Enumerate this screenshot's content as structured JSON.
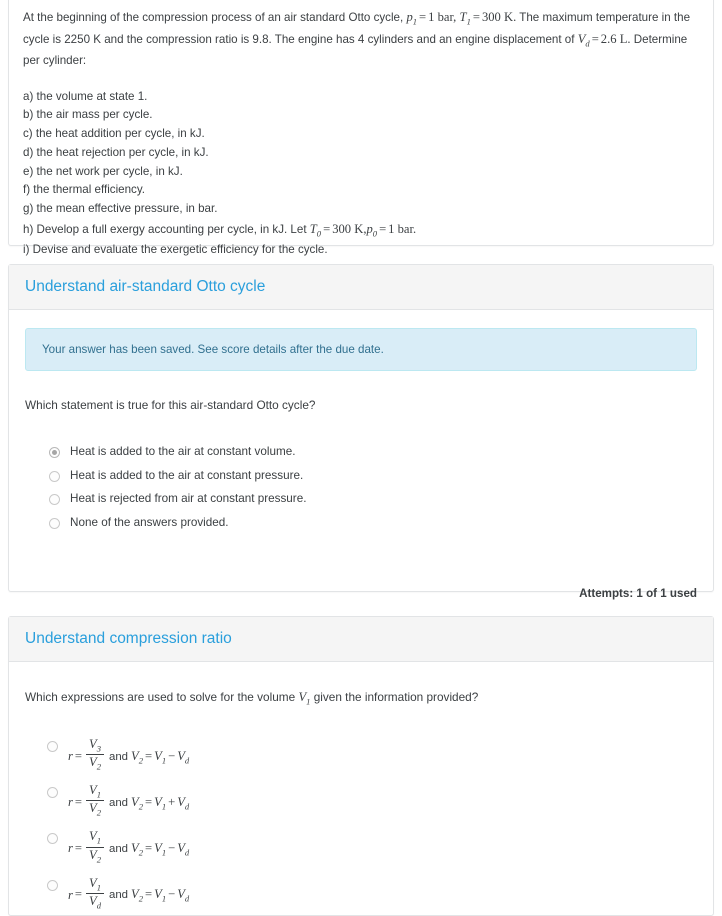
{
  "problem": {
    "statement_part1": "At the beginning of the compression process of an air standard Otto cycle, ",
    "p1_symbol": "p",
    "p1_sub": "1",
    "eq": "=",
    "p1_value": "1 bar,",
    "t1_symbol": "T",
    "t1_sub": "1",
    "t1_value": "300 K.",
    "statement_part2": "The maximum temperature in the cycle is 2250 K and the compression ratio is 9.8. The engine has 4 cylinders and an engine displacement of ",
    "vd_symbol": "V",
    "vd_sub": "d",
    "vd_value": "2.6 L.",
    "statement_part3": "Determine per cylinder:",
    "items": [
      "a) the volume at state 1.",
      "b) the air mass per cycle.",
      "c) the heat addition per cycle, in kJ.",
      "d) the heat rejection per cycle, in kJ.",
      "e) the net work per cycle, in kJ.",
      "f) the thermal efficiency.",
      "g) the mean effective pressure, in bar."
    ],
    "item_h_prefix": "h) Develop a full exergy accounting per cycle, in kJ. Let ",
    "item_h_t0": "T",
    "item_h_t0_sub": "0",
    "item_h_t0_value": "300 K,",
    "item_h_p0": "p",
    "item_h_p0_sub": "0",
    "item_h_p0_value": "1 bar.",
    "item_i": "i) Devise and evaluate the exergetic efficiency for the cycle."
  },
  "otto_section": {
    "header_title": "Understand air-standard Otto cycle",
    "alert_text": "Your answer has been saved. See score details after the due date.",
    "question": "Which statement is true for this air-standard Otto cycle?",
    "options": [
      {
        "label": "Heat is added to the air at constant volume.",
        "selected": true
      },
      {
        "label": "Heat is added to the air at constant pressure.",
        "selected": false
      },
      {
        "label": "Heat is rejected from air at constant pressure.",
        "selected": false
      },
      {
        "label": "None of the answers provided.",
        "selected": false
      }
    ],
    "attempts_text": "Attempts: 1 of 1 used"
  },
  "ratio_section": {
    "header_title": "Understand compression ratio",
    "question_prefix": "Which expressions are used to solve for the volume ",
    "question_symbol": "V",
    "question_symbol_sub": "1",
    "question_suffix": " given the information provided?",
    "and_word": "and",
    "options": [
      {
        "r": "r",
        "eq": "=",
        "num": "V",
        "num_sub": "3",
        "den": "V",
        "den_sub": "2",
        "v2": "V",
        "v2_sub": "2",
        "eq2": "=",
        "t1": "V",
        "t1_sub": "1",
        "op": "−",
        "t2": "V",
        "t2_sub": "d",
        "selected": false
      },
      {
        "r": "r",
        "eq": "=",
        "num": "V",
        "num_sub": "1",
        "den": "V",
        "den_sub": "2",
        "v2": "V",
        "v2_sub": "2",
        "eq2": "=",
        "t1": "V",
        "t1_sub": "1",
        "op": "+",
        "t2": "V",
        "t2_sub": "d",
        "selected": false
      },
      {
        "r": "r",
        "eq": "=",
        "num": "V",
        "num_sub": "1",
        "den": "V",
        "den_sub": "2",
        "v2": "V",
        "v2_sub": "2",
        "eq2": "=",
        "t1": "V",
        "t1_sub": "1",
        "op": "−",
        "t2": "V",
        "t2_sub": "d",
        "selected": false
      },
      {
        "r": "r",
        "eq": "=",
        "num": "V",
        "num_sub": "1",
        "den": "V",
        "den_sub": "d",
        "v2": "V",
        "v2_sub": "2",
        "eq2": "=",
        "t1": "V",
        "t1_sub": "1",
        "op": "−",
        "t2": "V",
        "t2_sub": "d",
        "selected": false
      }
    ]
  },
  "colors": {
    "header_blue": "#2a9fdc",
    "alert_bg": "#d9edf7",
    "alert_border": "#bce8f1",
    "alert_text": "#31708f",
    "card_border": "#e2e4e6",
    "header_bg": "#f5f5f5",
    "body_text": "#3c4043"
  }
}
